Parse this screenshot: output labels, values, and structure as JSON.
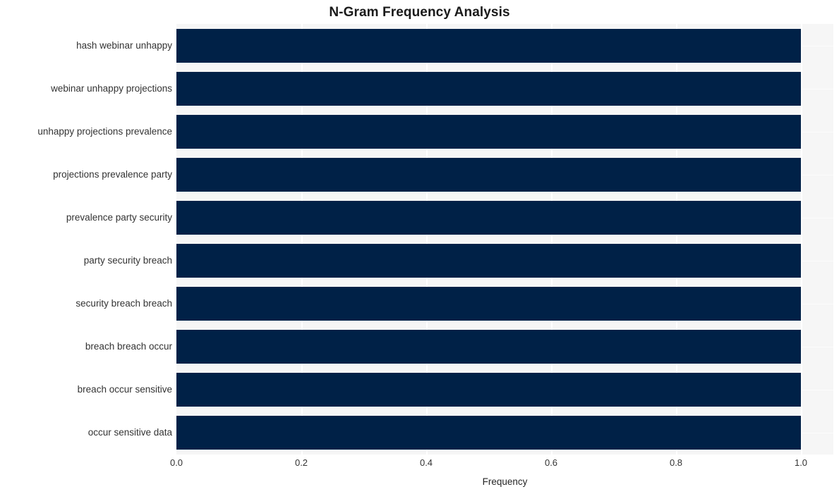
{
  "chart": {
    "title": "N-Gram Frequency Analysis",
    "xlabel": "Frequency",
    "ylabel": "",
    "bar_color": "#002147",
    "plot_background": "#f6f6f6",
    "grid_color": "#ffffff"
  },
  "axis": {
    "xticks": [
      "0.0",
      "0.2",
      "0.4",
      "0.6",
      "0.8",
      "1.0"
    ]
  },
  "chart_data": {
    "type": "bar",
    "orientation": "horizontal",
    "title": "N-Gram Frequency Analysis",
    "xlabel": "Frequency",
    "ylabel": "",
    "xlim": [
      0.0,
      1.0
    ],
    "xticks": [
      0.0,
      0.2,
      0.4,
      0.6,
      0.8,
      1.0
    ],
    "grid": true,
    "legend": null,
    "categories": [
      "hash webinar unhappy",
      "webinar unhappy projections",
      "unhappy projections prevalence",
      "projections prevalence party",
      "prevalence party security",
      "party security breach",
      "security breach breach",
      "breach breach occur",
      "breach occur sensitive",
      "occur sensitive data"
    ],
    "values": [
      1.0,
      1.0,
      1.0,
      1.0,
      1.0,
      1.0,
      1.0,
      1.0,
      1.0,
      1.0
    ],
    "series": [
      {
        "name": "Frequency",
        "color": "#002147",
        "values": [
          1.0,
          1.0,
          1.0,
          1.0,
          1.0,
          1.0,
          1.0,
          1.0,
          1.0,
          1.0
        ]
      }
    ]
  }
}
